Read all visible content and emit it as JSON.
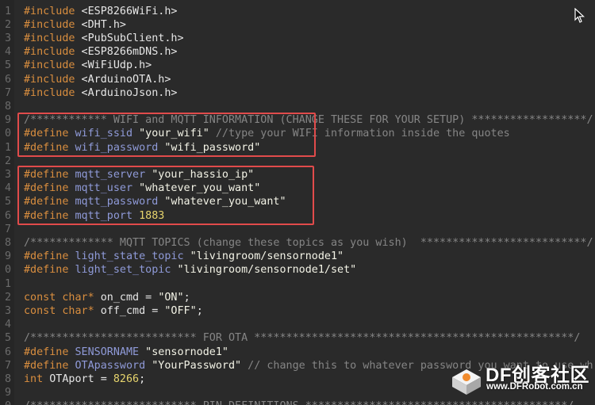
{
  "editor": {
    "lines": [
      {
        "n": "1",
        "t": [
          {
            "c": "kw",
            "v": "#include"
          },
          {
            "c": "txt",
            "v": " <ESP8266WiFi.h>"
          }
        ]
      },
      {
        "n": "2",
        "t": [
          {
            "c": "kw",
            "v": "#include"
          },
          {
            "c": "txt",
            "v": " <DHT.h>"
          }
        ]
      },
      {
        "n": "3",
        "t": [
          {
            "c": "kw",
            "v": "#include"
          },
          {
            "c": "txt",
            "v": " <PubSubClient.h>"
          }
        ]
      },
      {
        "n": "4",
        "t": [
          {
            "c": "kw",
            "v": "#include"
          },
          {
            "c": "txt",
            "v": " <ESP8266mDNS.h>"
          }
        ]
      },
      {
        "n": "5",
        "t": [
          {
            "c": "kw",
            "v": "#include"
          },
          {
            "c": "txt",
            "v": " <WiFiUdp.h>"
          }
        ]
      },
      {
        "n": "6",
        "t": [
          {
            "c": "kw",
            "v": "#include"
          },
          {
            "c": "txt",
            "v": " <ArduinoOTA.h>"
          }
        ]
      },
      {
        "n": "7",
        "t": [
          {
            "c": "kw",
            "v": "#include"
          },
          {
            "c": "txt",
            "v": " <ArduinoJson.h>"
          }
        ]
      },
      {
        "n": "8",
        "t": []
      },
      {
        "n": "9",
        "t": [
          {
            "c": "cmt",
            "v": "/************ WIFI and MQTT INFORMATION (CHANGE THESE FOR YOUR SETUP) ******************/"
          }
        ]
      },
      {
        "n": "0",
        "t": [
          {
            "c": "kw",
            "v": "#define"
          },
          {
            "c": "mac",
            "v": " wifi_ssid"
          },
          {
            "c": "str",
            "v": " \"your_wifi\""
          },
          {
            "c": "cmt",
            "v": " //type your WIFI information inside the quotes"
          }
        ]
      },
      {
        "n": "1",
        "t": [
          {
            "c": "kw",
            "v": "#define"
          },
          {
            "c": "mac",
            "v": " wifi_password"
          },
          {
            "c": "str",
            "v": " \"wifi_password\""
          }
        ]
      },
      {
        "n": "2",
        "t": []
      },
      {
        "n": "3",
        "t": [
          {
            "c": "kw",
            "v": "#define"
          },
          {
            "c": "mac",
            "v": " mqtt_server"
          },
          {
            "c": "str",
            "v": " \"your_hassio_ip\""
          }
        ]
      },
      {
        "n": "4",
        "t": [
          {
            "c": "kw",
            "v": "#define"
          },
          {
            "c": "mac",
            "v": " mqtt_user"
          },
          {
            "c": "str",
            "v": " \"whatever_you_want\""
          }
        ]
      },
      {
        "n": "5",
        "t": [
          {
            "c": "kw",
            "v": "#define"
          },
          {
            "c": "mac",
            "v": " mqtt_password"
          },
          {
            "c": "str",
            "v": " \"whatever_you_want\""
          }
        ]
      },
      {
        "n": "6",
        "t": [
          {
            "c": "kw",
            "v": "#define"
          },
          {
            "c": "mac",
            "v": " mqtt_port"
          },
          {
            "c": "num",
            "v": " 1883"
          }
        ]
      },
      {
        "n": "7",
        "t": []
      },
      {
        "n": "8",
        "t": [
          {
            "c": "cmt",
            "v": "/************* MQTT TOPICS (change these topics as you wish)  **************************/"
          }
        ]
      },
      {
        "n": "9",
        "t": [
          {
            "c": "kw",
            "v": "#define"
          },
          {
            "c": "mac",
            "v": " light_state_topic"
          },
          {
            "c": "str",
            "v": " \"livingroom/sensornode1\""
          }
        ]
      },
      {
        "n": "0",
        "t": [
          {
            "c": "kw",
            "v": "#define"
          },
          {
            "c": "mac",
            "v": " light_set_topic"
          },
          {
            "c": "str",
            "v": " \"livingroom/sensornode1/set\""
          }
        ]
      },
      {
        "n": "1",
        "t": []
      },
      {
        "n": "2",
        "t": [
          {
            "c": "kw",
            "v": "const"
          },
          {
            "c": "kw",
            "v": " char"
          },
          {
            "c": "ptr",
            "v": "*"
          },
          {
            "c": "txt",
            "v": " on_cmd = "
          },
          {
            "c": "str",
            "v": "\"ON\""
          },
          {
            "c": "txt",
            "v": ";"
          }
        ]
      },
      {
        "n": "3",
        "t": [
          {
            "c": "kw",
            "v": "const"
          },
          {
            "c": "kw",
            "v": " char"
          },
          {
            "c": "ptr",
            "v": "*"
          },
          {
            "c": "txt",
            "v": " off_cmd = "
          },
          {
            "c": "str",
            "v": "\"OFF\""
          },
          {
            "c": "txt",
            "v": ";"
          }
        ]
      },
      {
        "n": "4",
        "t": []
      },
      {
        "n": "5",
        "t": [
          {
            "c": "cmt",
            "v": "/************************** FOR OTA **************************************************/"
          }
        ]
      },
      {
        "n": "6",
        "t": [
          {
            "c": "kw",
            "v": "#define"
          },
          {
            "c": "mac",
            "v": " SENSORNAME"
          },
          {
            "c": "str",
            "v": " \"sensornode1\""
          }
        ]
      },
      {
        "n": "7",
        "t": [
          {
            "c": "kw",
            "v": "#define"
          },
          {
            "c": "mac",
            "v": " OTApassword"
          },
          {
            "c": "str",
            "v": " \"YourPassword\""
          },
          {
            "c": "cmt",
            "v": " // change this to whatever password you want to use wh"
          }
        ]
      },
      {
        "n": "8",
        "t": [
          {
            "c": "kw",
            "v": "int"
          },
          {
            "c": "txt",
            "v": " OTAport = "
          },
          {
            "c": "num",
            "v": "8266"
          },
          {
            "c": "txt",
            "v": ";"
          }
        ]
      },
      {
        "n": "9",
        "t": []
      },
      {
        "n": "0",
        "t": [
          {
            "c": "cmt",
            "v": "/************************** PIN DEFINITIONS *****************************************/"
          }
        ]
      }
    ]
  },
  "watermark": {
    "brand": "DF创客社区",
    "url": "www.DFRobot.com.cn"
  },
  "colors": {
    "highlight_box": "#e14b4b",
    "background": "#2a2a2a"
  }
}
